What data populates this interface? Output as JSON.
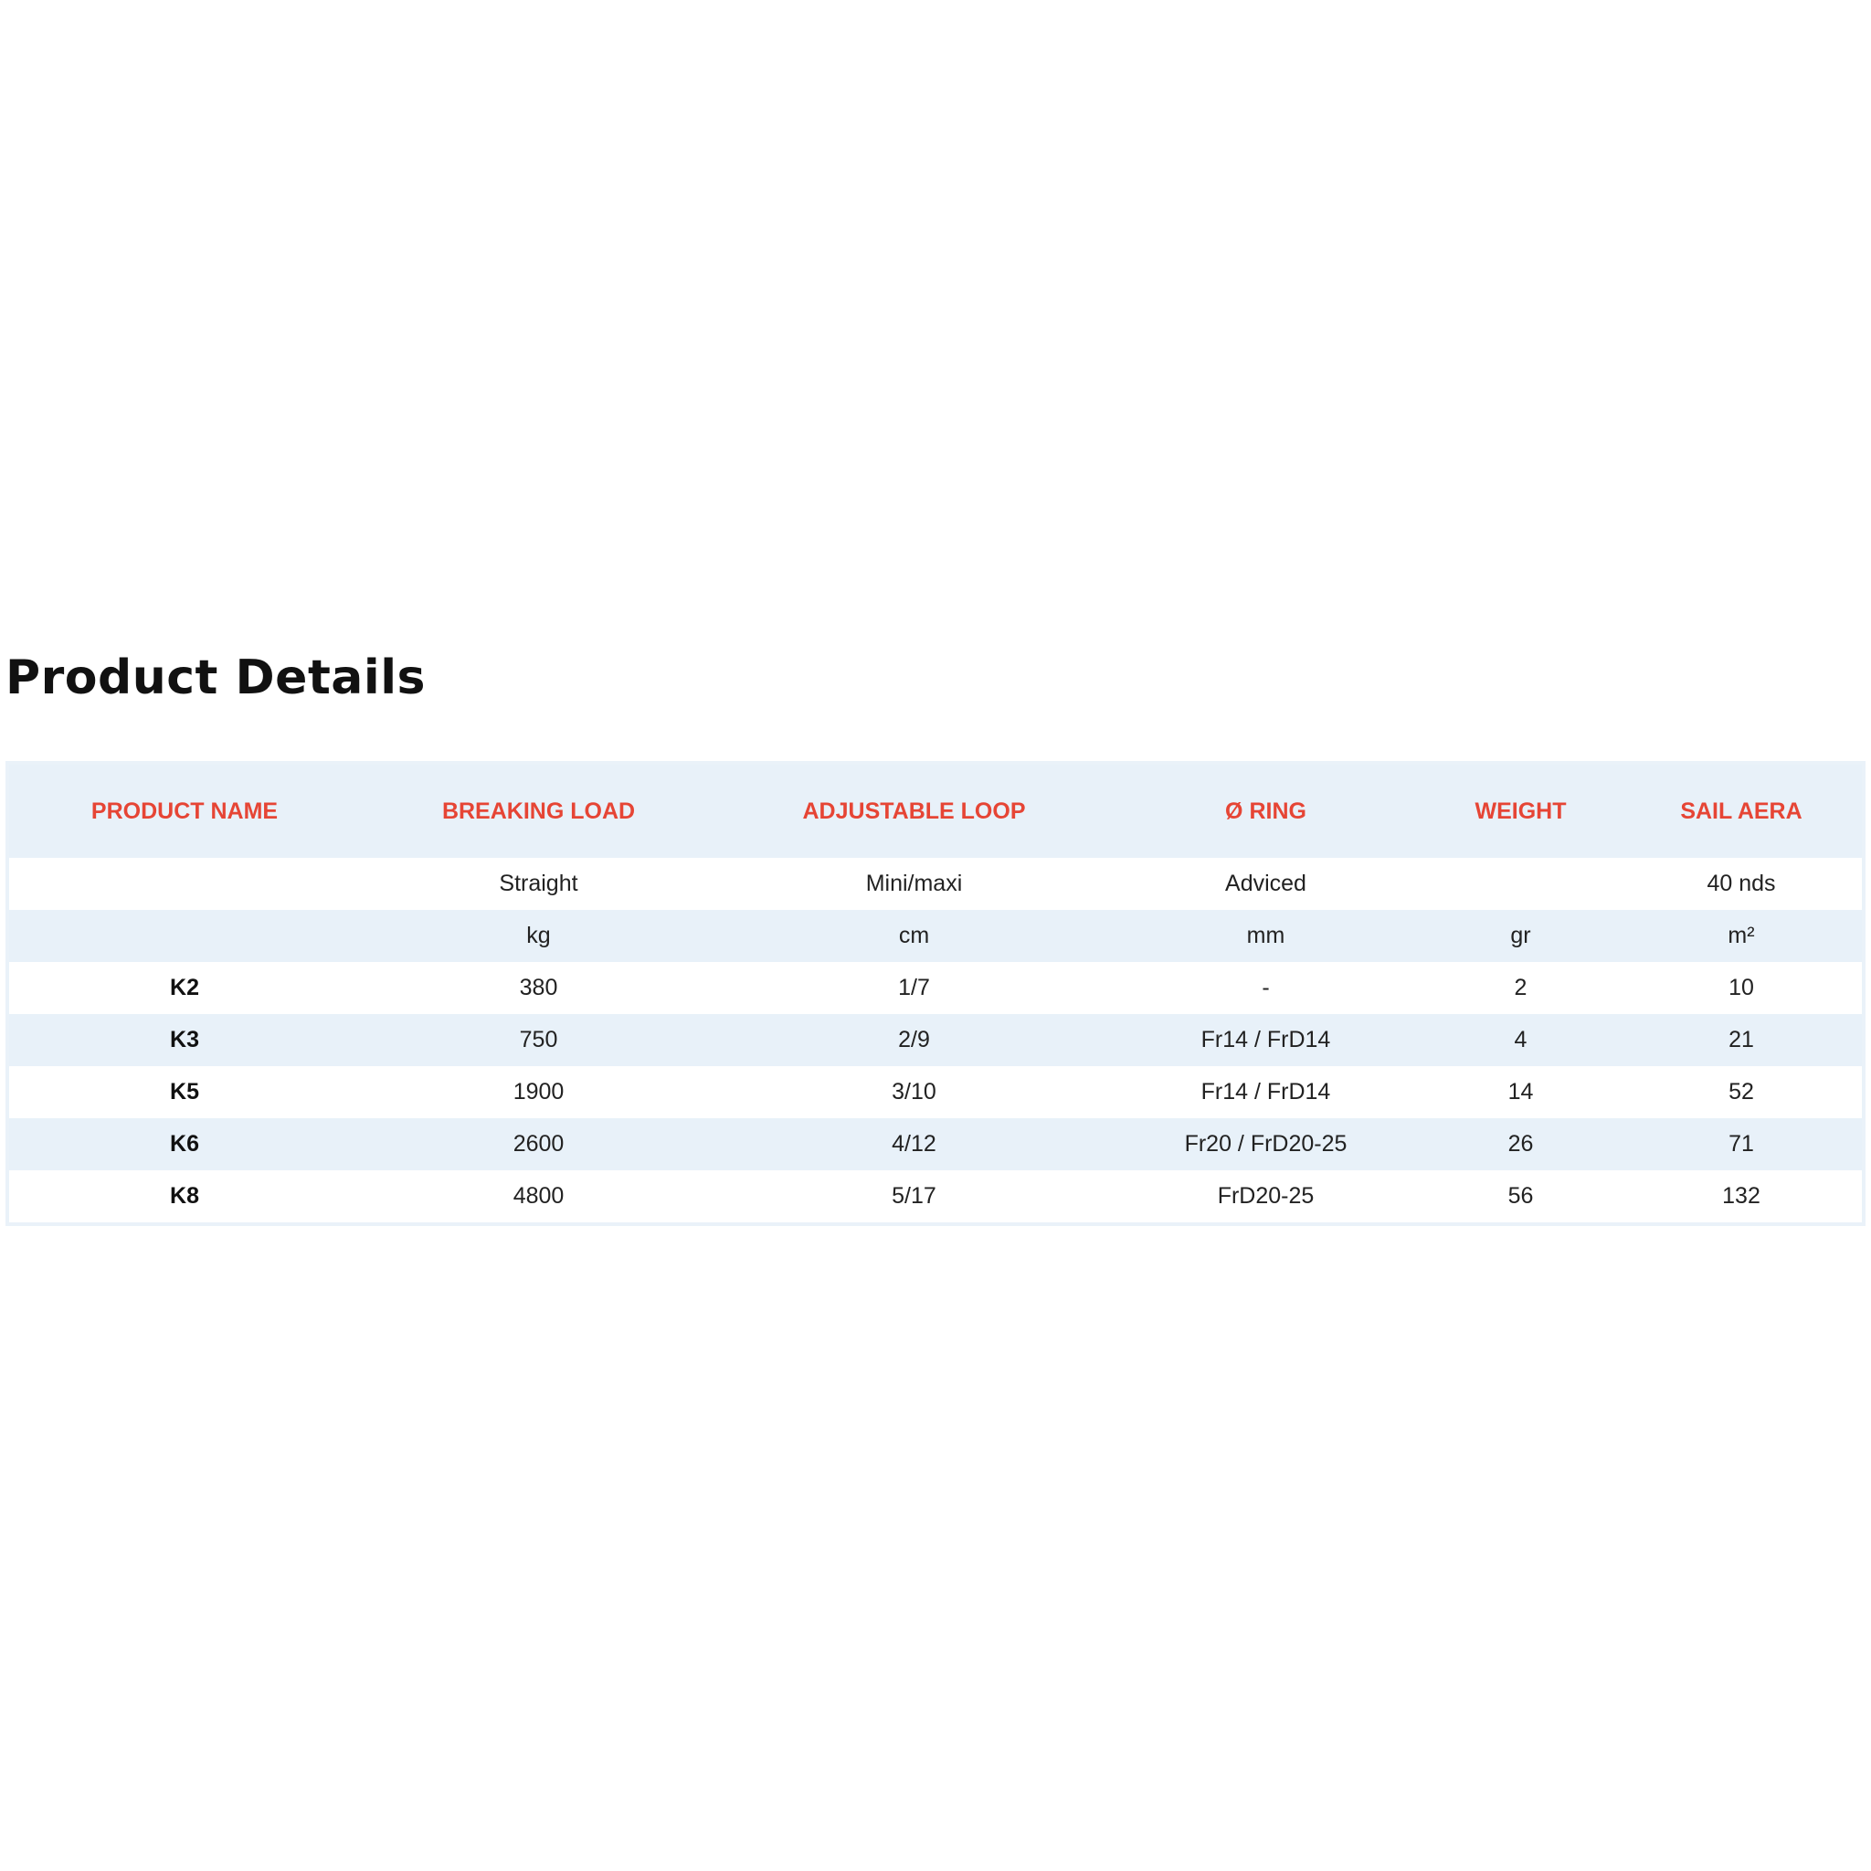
{
  "page_title": "Product Details",
  "table": {
    "headers": [
      "PRODUCT NAME",
      "BREAKING LOAD",
      "ADJUSTABLE LOOP",
      "Ø RING",
      "WEIGHT",
      "SAIL AERA"
    ],
    "subheader_rows": [
      [
        "",
        "Straight",
        "Mini/maxi",
        "Adviced",
        "",
        "40 nds"
      ],
      [
        "",
        "kg",
        "cm",
        "mm",
        "gr",
        "m²"
      ]
    ],
    "rows": [
      [
        "K2",
        "380",
        "1/7",
        "-",
        "2",
        "10"
      ],
      [
        "K3",
        "750",
        "2/9",
        "Fr14 / FrD14",
        "4",
        "21"
      ],
      [
        "K5",
        "1900",
        "3/10",
        "Fr14 / FrD14",
        "14",
        "52"
      ],
      [
        "K6",
        "2600",
        "4/12",
        "Fr20 / FrD20-25",
        "26",
        "71"
      ],
      [
        "K8",
        "4800",
        "5/17",
        "FrD20-25",
        "56",
        "132"
      ]
    ]
  },
  "colors": {
    "header_text": "#e64535",
    "stripe": "#e8f1f9"
  }
}
